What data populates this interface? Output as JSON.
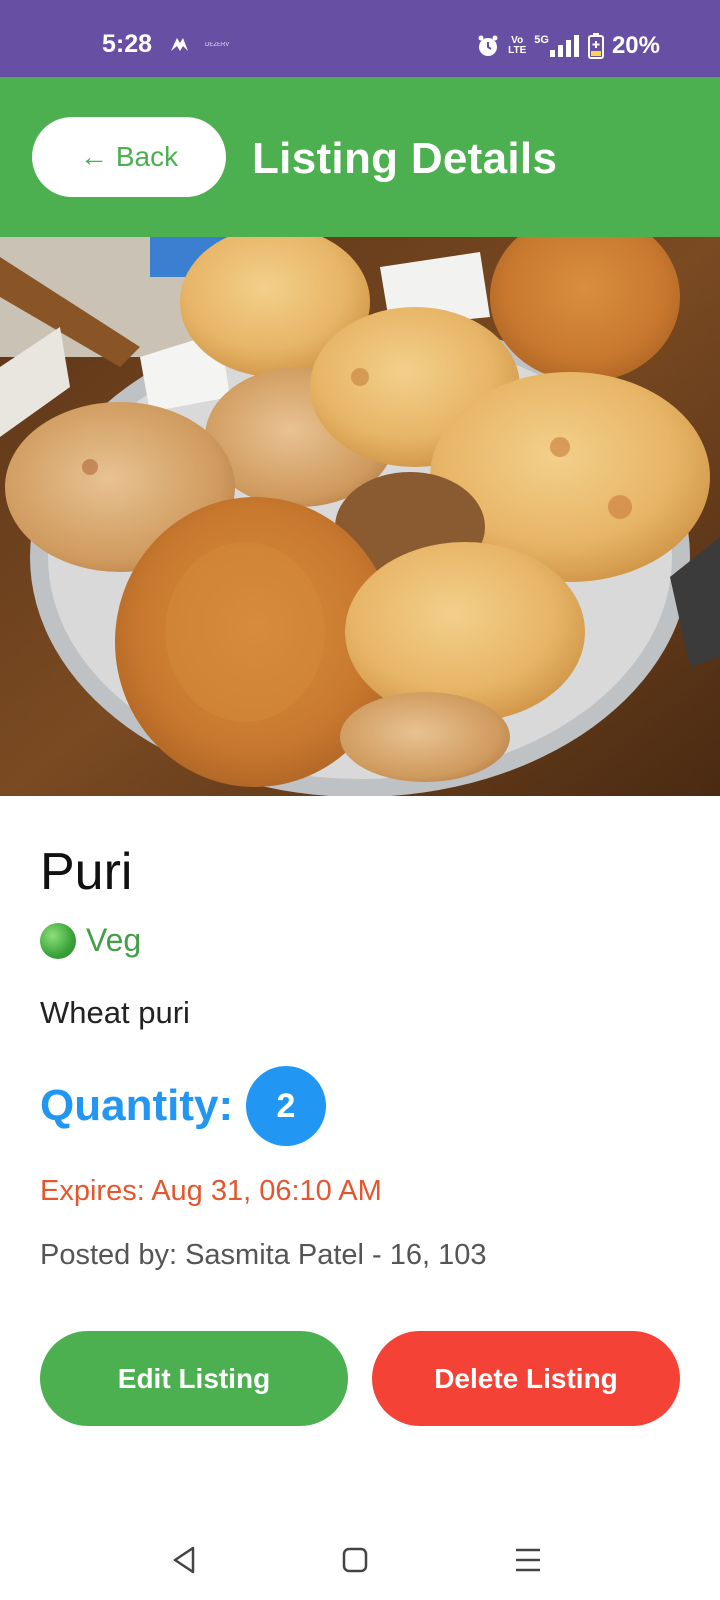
{
  "status_bar": {
    "time": "5:28",
    "small_text": "DEZERV",
    "net_top": "Vo",
    "net_bottom": "LTE",
    "signal_label": "5G",
    "battery": "20%"
  },
  "app_bar": {
    "back_arrow": "←",
    "back_label": "Back",
    "title": "Listing Details",
    "color": "#4caf50"
  },
  "listing": {
    "image_alt": "Plate of puri",
    "title": "Puri",
    "diet_label": "Veg",
    "description": "Wheat puri",
    "quantity_label": "Quantity:",
    "quantity_value": "2",
    "expires": "Expires: Aug 31, 06:10 AM",
    "posted_by": "Posted by: Sasmita Patel - 16, 103"
  },
  "actions": {
    "edit_label": "Edit Listing",
    "delete_label": "Delete Listing"
  },
  "nav_bar": {
    "back_icon": "triangle-back-icon",
    "home_icon": "square-home-icon",
    "menu_icon": "hamburger-menu-icon"
  },
  "colors": {
    "status_bar": "#6750a4",
    "primary_green": "#4caf50",
    "quantity_blue": "#2196f3",
    "expires_orange": "#e4572e",
    "delete_red": "#f44336"
  }
}
